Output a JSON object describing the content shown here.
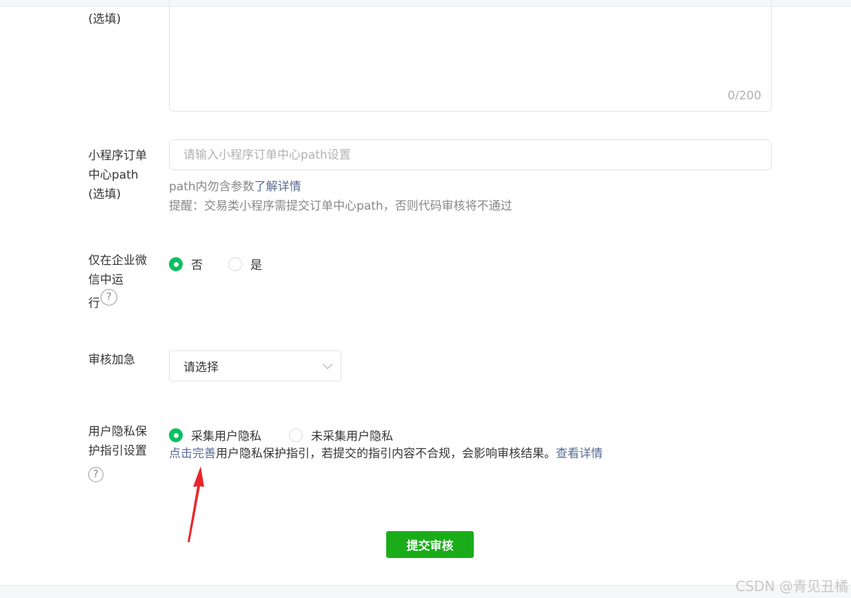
{
  "remark_field": {
    "label_suffix": "(选填)",
    "counter": "0/200"
  },
  "order_path_field": {
    "label_lines": [
      "小程序订单",
      "中心path",
      "(选填)"
    ],
    "placeholder": "请输入小程序订单中心path设置",
    "hint_prefix": "path内勿含参数",
    "hint_link": "了解详情",
    "reminder": "提醒：交易类小程序需提交订单中心path，否则代码审核将不通过"
  },
  "wecom_only_field": {
    "label_lines": [
      "仅在企业微",
      "信中运",
      "行"
    ],
    "help_icon": "question-circle-icon",
    "help_glyph": "?",
    "options": [
      "否",
      "是"
    ],
    "selected": "否"
  },
  "expedite_field": {
    "label": "审核加急",
    "select_value": "请选择"
  },
  "privacy_field": {
    "label_lines": [
      "用户隐私保",
      "护指引设置"
    ],
    "help_icon": "question-circle-icon",
    "help_glyph": "?",
    "options": [
      "采集用户隐私",
      "未采集用户隐私"
    ],
    "selected": "采集用户隐私",
    "note_link": "点击完善",
    "note_text": "用户隐私保护指引，若提交的指引内容不合规，会影响审核结果。",
    "note_link2": "查看详情"
  },
  "submit_label": "提交审核",
  "watermark": "CSDN @青见丑橘",
  "colors": {
    "accent_green": "#07c160",
    "button_green": "#1aad19",
    "link_blue": "#576b95",
    "annotation_red": "#e8262b"
  }
}
